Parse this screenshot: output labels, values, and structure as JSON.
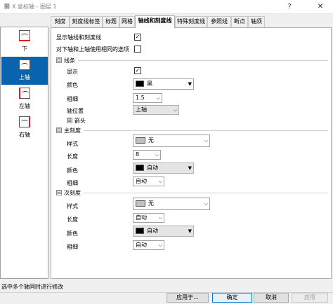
{
  "window": {
    "title": "X 坐标轴 - 图层 1",
    "app_icon": "axis-app-icon",
    "help_label": "?",
    "close_label": "✕"
  },
  "left_panel": {
    "items": [
      {
        "label": "下",
        "icon": "bottom-axis-icon"
      },
      {
        "label": "上轴",
        "icon": "top-axis-icon",
        "selected": true
      },
      {
        "label": "左轴",
        "icon": "left-axis-icon"
      },
      {
        "label": "右轴",
        "icon": "right-axis-icon"
      }
    ]
  },
  "tabs": [
    "刻度",
    "刻度线标签",
    "标题",
    "网格",
    "轴线和刻度线",
    "特殊刻度线",
    "参照线",
    "断点",
    "轴须"
  ],
  "active_tab": "轴线和刻度线",
  "content": {
    "show_axis_ticks_label": "显示轴线和刻度线",
    "show_axis_ticks_checked": "✓",
    "same_options_label": "对下轴和上轴使用相同的选项",
    "line_section": {
      "toggle": "⊟",
      "title": "线条",
      "show_label": "显示",
      "show_checked": "✓",
      "color_label": "颜色",
      "color_value": "黑",
      "color_hex": "#000000",
      "thickness_label": "粗细",
      "thickness_value": "1.5",
      "axis_position_label": "轴位置",
      "axis_position_value": "上轴",
      "arrow_toggle": "⊞",
      "arrow_label": "箭头"
    },
    "major_section": {
      "toggle": "⊟",
      "title": "主刻度",
      "style_label": "样式",
      "style_value": "无",
      "length_label": "长度",
      "length_value": "8",
      "color_label": "颜色",
      "color_value": "自动",
      "color_hex": "#000000",
      "thickness_label": "粗细",
      "thickness_value": "自动"
    },
    "minor_section": {
      "toggle": "⊟",
      "title": "次刻度",
      "style_label": "样式",
      "style_value": "无",
      "length_label": "长度",
      "length_value": "自动",
      "color_label": "颜色",
      "color_value": "自动",
      "color_hex": "#000000",
      "thickness_label": "粗细",
      "thickness_value": "自动"
    }
  },
  "status": "选中多个轴同时进行修改",
  "buttons": {
    "apply_to": "应用于...",
    "ok": "确定",
    "cancel": "取消",
    "apply": "应用"
  },
  "colors": {
    "selection": "#0a64ad",
    "style_swatch": "#c0c0c0"
  }
}
